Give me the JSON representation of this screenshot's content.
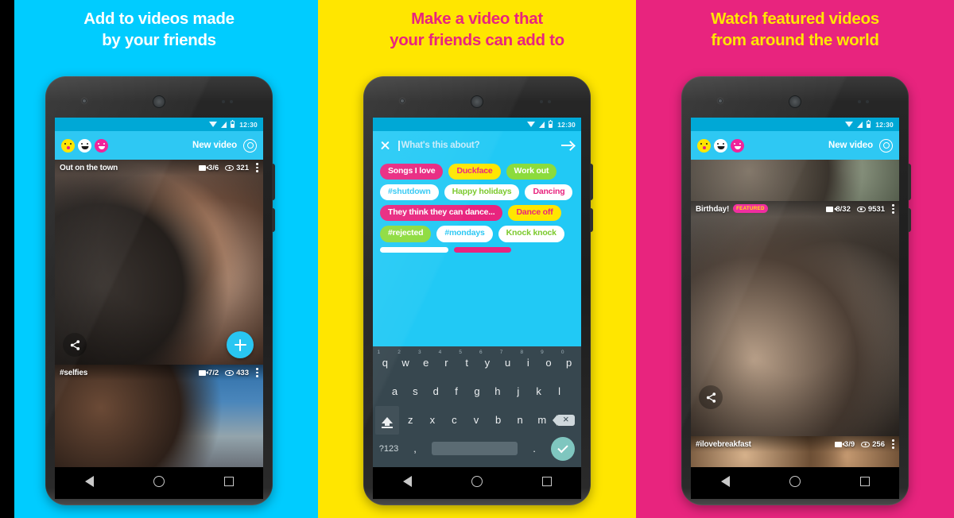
{
  "panels": [
    {
      "headline_line1": "Add to videos made",
      "headline_line2": "by your friends",
      "bg": "#00CCFF",
      "headline_color": "#FFFFFF"
    },
    {
      "headline_line1": "Make a video that",
      "headline_line2": "your friends can add to",
      "bg": "#FFE600",
      "headline_color": "#E8247E"
    },
    {
      "headline_line1": "Watch featured videos",
      "headline_line2": "from around the world",
      "bg": "#E8247E",
      "headline_color": "#FFE600"
    }
  ],
  "status_bar": {
    "time": "12:30",
    "wifi_icon": "wifi-icon",
    "signal_icon": "signal-icon",
    "battery_icon": "battery-icon"
  },
  "app_bar": {
    "new_video_label": "New video",
    "settings_icon": "gear-icon",
    "emoji_icons": [
      "surprised-emoji-icon",
      "smile-emoji-icon",
      "happy-emoji-icon"
    ]
  },
  "nav_bar": {
    "back_icon": "back-triangle-icon",
    "home_icon": "home-circle-icon",
    "recents_icon": "recents-square-icon"
  },
  "phone1": {
    "cards": [
      {
        "title": "Out on the town",
        "clips": "3/6",
        "views": "321",
        "camera_icon": "video-camera-icon",
        "eye_icon": "eye-views-icon",
        "overflow_icon": "kebab-menu-icon",
        "featured": false
      },
      {
        "title": "#selfies",
        "clips": "7/2",
        "views": "433",
        "camera_icon": "video-camera-icon",
        "eye_icon": "eye-views-icon",
        "overflow_icon": "kebab-menu-icon",
        "featured": false
      }
    ],
    "share_icon": "share-icon",
    "add_icon": "plus-icon"
  },
  "phone2": {
    "compose": {
      "close_icon": "close-x-icon",
      "placeholder": "What's this about?",
      "submit_icon": "arrow-right-icon"
    },
    "tags": [
      {
        "label": "Songs I love",
        "style": "t-pink"
      },
      {
        "label": "Duckface",
        "style": "t-yellow"
      },
      {
        "label": "Work out",
        "style": "t-green"
      },
      {
        "label": "#shutdown",
        "style": "t-white-teal"
      },
      {
        "label": "Happy holidays",
        "style": "t-white-green"
      },
      {
        "label": "Dancing",
        "style": "t-white-pink"
      },
      {
        "label": "They think they can dance...",
        "style": "t-pink"
      },
      {
        "label": "Dance off",
        "style": "t-yellow-pink"
      },
      {
        "label": "#rejected",
        "style": "t-green-white"
      },
      {
        "label": "#mondays",
        "style": "t-white-teal"
      },
      {
        "label": "Knock knock",
        "style": "t-white-green"
      }
    ],
    "keyboard": {
      "row1": [
        {
          "key": "q",
          "num": "1"
        },
        {
          "key": "w",
          "num": "2"
        },
        {
          "key": "e",
          "num": "3"
        },
        {
          "key": "r",
          "num": "4"
        },
        {
          "key": "t",
          "num": "5"
        },
        {
          "key": "y",
          "num": "6"
        },
        {
          "key": "u",
          "num": "7"
        },
        {
          "key": "i",
          "num": "8"
        },
        {
          "key": "o",
          "num": "9"
        },
        {
          "key": "p",
          "num": "0"
        }
      ],
      "row2": [
        "a",
        "s",
        "d",
        "f",
        "g",
        "h",
        "j",
        "k",
        "l"
      ],
      "row3": [
        "z",
        "x",
        "c",
        "v",
        "b",
        "n",
        "m"
      ],
      "shift_icon": "shift-arrow-icon",
      "delete_icon": "backspace-icon",
      "symbols_label": "?123",
      "comma_label": ",",
      "period_label": ".",
      "enter_icon": "check-icon"
    }
  },
  "phone3": {
    "cards": [
      {
        "title": "Birthday!",
        "featured_label": "FEATURED",
        "clips": "8/32",
        "views": "9531",
        "camera_icon": "video-camera-icon",
        "eye_icon": "eye-views-icon",
        "overflow_icon": "kebab-menu-icon",
        "featured": true
      },
      {
        "title": "#ilovebreakfast",
        "clips": "3/9",
        "views": "256",
        "camera_icon": "video-camera-icon",
        "eye_icon": "eye-views-icon",
        "overflow_icon": "kebab-menu-icon",
        "featured": false
      }
    ],
    "share_icon": "share-icon"
  },
  "colors": {
    "cyan": "#00CCFF",
    "yellow": "#FFE600",
    "pink": "#E8247E",
    "app_bar_cyan": "#2EC8F3",
    "green": "#8CDB3C",
    "white": "#FFFFFF"
  }
}
